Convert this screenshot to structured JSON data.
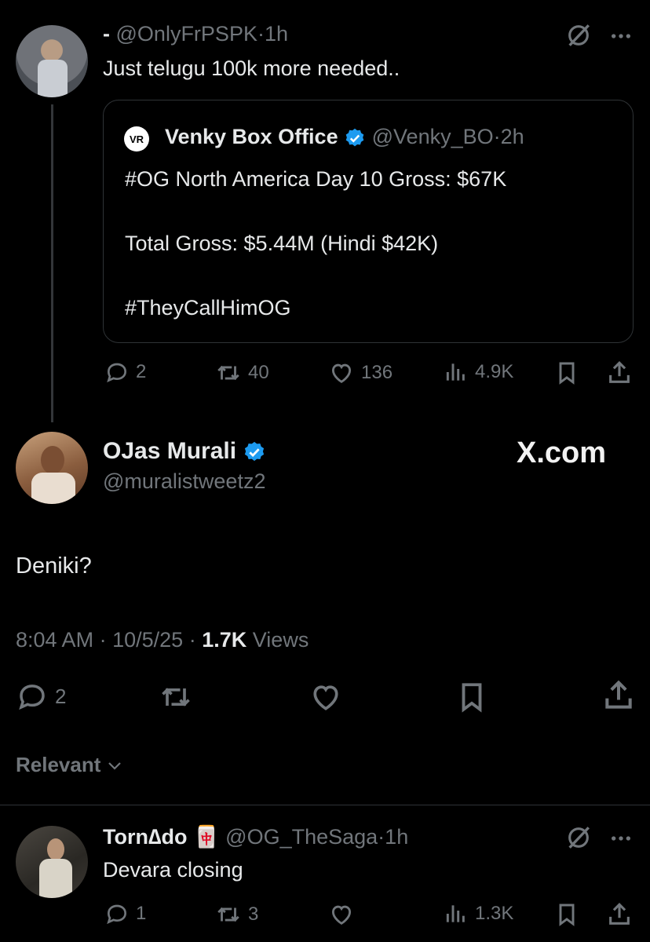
{
  "reply_parent": {
    "display_name": "-",
    "handle": "@OnlyFrPSPK",
    "time": "1h",
    "text": "Just telugu 100k more needed..",
    "quote": {
      "display_name": "Venky Box Office",
      "handle": "@Venky_BO",
      "time": "2h",
      "line1": "#OG North America Day 10 Gross: $67K",
      "line2": "Total Gross: $5.44M (Hindi $42K)",
      "line3": "#TheyCallHimOG",
      "logo_text": "VR"
    },
    "actions": {
      "replies": "2",
      "reposts": "40",
      "likes": "136",
      "views": "4.9K"
    }
  },
  "main_post": {
    "display_name": "OJas Murali",
    "handle": "@muralistweetz2",
    "watermark": "X.com",
    "text": "Deniki?",
    "time": "8:04 AM",
    "date": "10/5/25",
    "views_count": "1.7K",
    "views_label": "Views",
    "actions": {
      "replies": "2"
    }
  },
  "sort": {
    "label": "Relevant"
  },
  "reply": {
    "display_name": "Torn∆do",
    "emoji": "🀄",
    "handle": "@OG_TheSaga",
    "time": "1h",
    "text": "Devara closing",
    "actions": {
      "replies": "1",
      "reposts": "3",
      "views": "1.3K"
    }
  },
  "separator": "·",
  "colors": {
    "background": "#000000",
    "text": "#e7e9ea",
    "muted": "#71767b",
    "verified": "#1d9bf0",
    "border": "#2f3336"
  }
}
